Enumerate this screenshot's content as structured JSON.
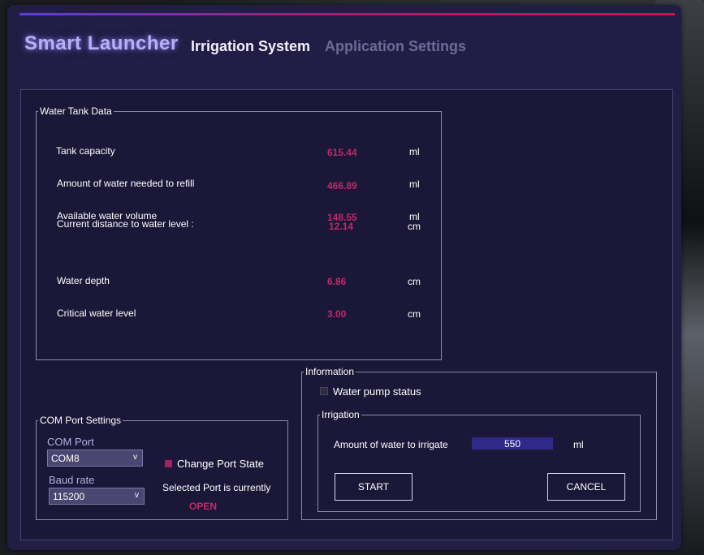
{
  "window": {
    "accent_colors": [
      "#5b3fd6",
      "#a41f6c",
      "#d0124f"
    ]
  },
  "header": {
    "app_title": "Smart Launcher",
    "tabs": [
      {
        "label": "Irrigation System",
        "active": true
      },
      {
        "label": "Application Settings",
        "active": false
      }
    ]
  },
  "water_tank": {
    "group_title": "Water Tank Data",
    "rows": [
      {
        "label": "Tank capacity",
        "value": "615.44",
        "unit": "ml"
      },
      {
        "label": "Amount of water needed to refill",
        "value": "466.89",
        "unit": "ml"
      },
      {
        "label": "Available water volume",
        "value": "148.55",
        "unit": "ml"
      },
      {
        "label": "Current distance to water level :",
        "value": "12.14",
        "unit": "cm"
      },
      {
        "label": "Water depth",
        "value": "6.86",
        "unit": "cm"
      },
      {
        "label": "Critical water level",
        "value": "3.00",
        "unit": "cm"
      }
    ]
  },
  "com_port": {
    "group_title": "COM Port Settings",
    "port_label": "COM Port",
    "port_value": "COM8",
    "baud_label": "Baud rate",
    "baud_value": "115200",
    "dropdown_arrow": "v",
    "change_state_label": "Change Port State",
    "selected_port_text": "Selected Port is currently",
    "port_state": "OPEN",
    "checkbox_color": "#a3245a"
  },
  "information": {
    "group_title": "Information",
    "pump_status_label": "Water pump status",
    "irrigation": {
      "group_title": "Irrigation",
      "amount_label": "Amount of water to irrigate",
      "amount_value": "550",
      "unit": "ml",
      "start_label": "START",
      "cancel_label": "CANCEL"
    }
  }
}
